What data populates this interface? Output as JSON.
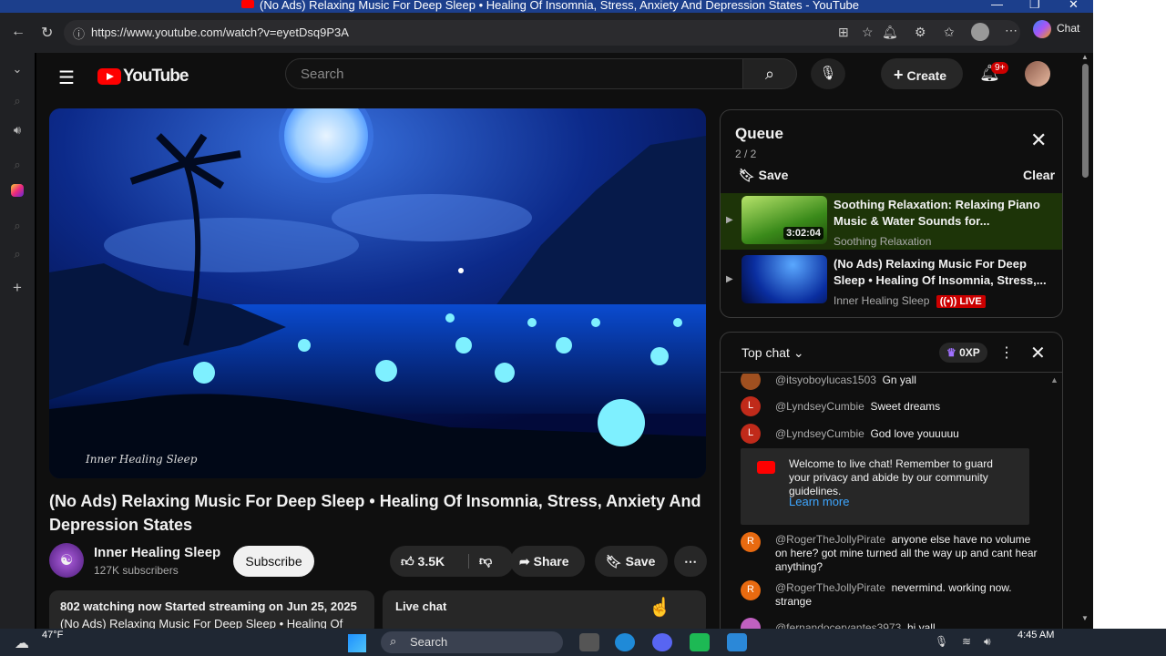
{
  "window": {
    "title": "(No Ads) Relaxing Music For Deep Sleep • Healing Of Insomnia, Stress, Anxiety And Depression States - YouTube",
    "minimize": "—",
    "restore": "❐",
    "close": "✕"
  },
  "browser": {
    "url": "https://www.youtube.com/watch?v=eyetDsq9P3A",
    "chat_label": "Chat"
  },
  "youtube": {
    "logo_text": "YouTube",
    "search_placeholder": "Search",
    "create_label": "Create",
    "notifications_badge": "9+"
  },
  "video": {
    "watermark": "Inner Healing Sleep",
    "title": "(No Ads) Relaxing Music For Deep Sleep • Healing Of Insomnia, Stress, Anxiety And Depression States",
    "channel_name": "Inner Healing Sleep",
    "subscribers": "127K subscribers",
    "subscribe_label": "Subscribe",
    "likes": "3.5K",
    "share_label": "Share",
    "save_label": "Save",
    "description_line1": "802 watching now  Started streaming on Jun 25, 2025",
    "description_line2": "(No Ads) Relaxing Music For Deep Sleep • Healing Of",
    "live_chat_label": "Live chat"
  },
  "queue": {
    "title": "Queue",
    "count": "2 / 2",
    "save_label": "Save",
    "clear_label": "Clear",
    "items": [
      {
        "title": "Soothing Relaxation: Relaxing Piano Music & Water Sounds for...",
        "channel": "Soothing Relaxation",
        "duration": "3:02:04"
      },
      {
        "title": "(No Ads) Relaxing Music For Deep Sleep • Healing Of Insomnia, Stress,...",
        "channel": "Inner Healing Sleep",
        "live": "LIVE"
      }
    ]
  },
  "chat": {
    "header": "Top chat",
    "xp": "0XP",
    "messages": [
      {
        "author": "@itsyoboylucas1503",
        "text": "Gn yall",
        "initial": ""
      },
      {
        "author": "@LyndseyCumbie",
        "text": "Sweet dreams",
        "initial": "L"
      },
      {
        "author": "@LyndseyCumbie",
        "text": "God love youuuuu",
        "initial": "L"
      },
      {
        "author": "@RogerTheJollyPirate",
        "text": "anyone else have no volume on here? got mine turned all the way up and cant hear anything?",
        "initial": "R"
      },
      {
        "author": "@RogerTheJollyPirate",
        "text": "nevermind. working now. strange",
        "initial": "R"
      },
      {
        "author": "@fernandocervantes3973",
        "text": "hi yall",
        "initial": ""
      }
    ],
    "welcome_text": "Welcome to live chat! Remember to guard your privacy and abide by our community guidelines.",
    "learn_more": "Learn more"
  },
  "taskbar": {
    "weather": "47°F",
    "search": "Search",
    "time": "4:45 AM"
  }
}
